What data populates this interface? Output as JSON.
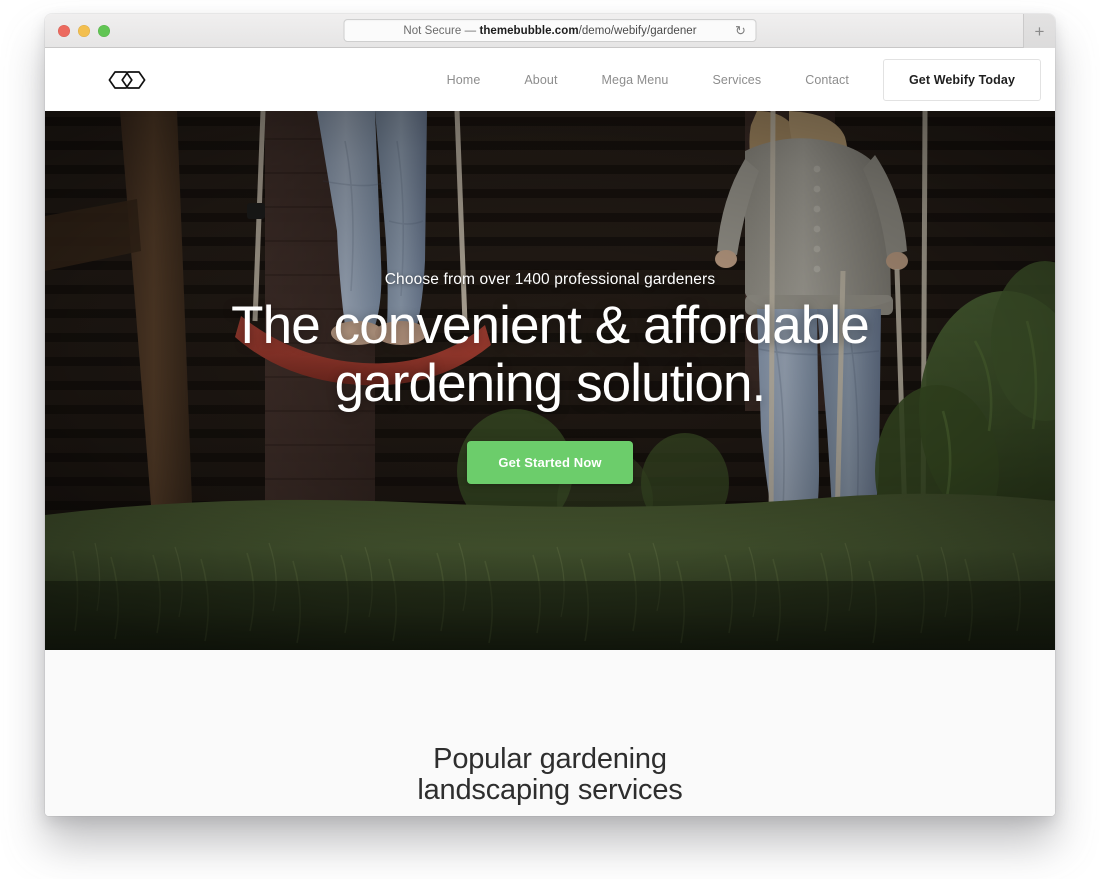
{
  "browser": {
    "traffic_lights": [
      "close",
      "minimize",
      "maximize"
    ],
    "url_security_label": "Not Secure",
    "url_separator": "—",
    "url_domain": "themebubble.com",
    "url_path": "/demo/webify/gardener",
    "reload_icon": "↻",
    "new_tab_icon": "+"
  },
  "site": {
    "logo_name": "webify-logo",
    "nav": [
      {
        "label": "Home"
      },
      {
        "label": "About"
      },
      {
        "label": "Mega Menu"
      },
      {
        "label": "Services"
      },
      {
        "label": "Contact"
      }
    ],
    "cta_label": "Get Webify Today"
  },
  "hero": {
    "subtitle": "Choose from over 1400 professional gardeners",
    "title_line1": "The convenient & affordable",
    "title_line2": "gardening solution.",
    "button_label": "Get Started Now",
    "button_color": "#6ccd6b",
    "image_description": "Two children standing on red swings in a grassy garden with a wooden fence"
  },
  "services": {
    "heading_line1": "Popular gardening",
    "heading_line2": "landscaping services"
  },
  "colors": {
    "accent_green": "#6ccd6b",
    "section_bg": "#fafafa",
    "nav_text": "#8d8d8d",
    "heading_text": "#2e2e2e"
  }
}
